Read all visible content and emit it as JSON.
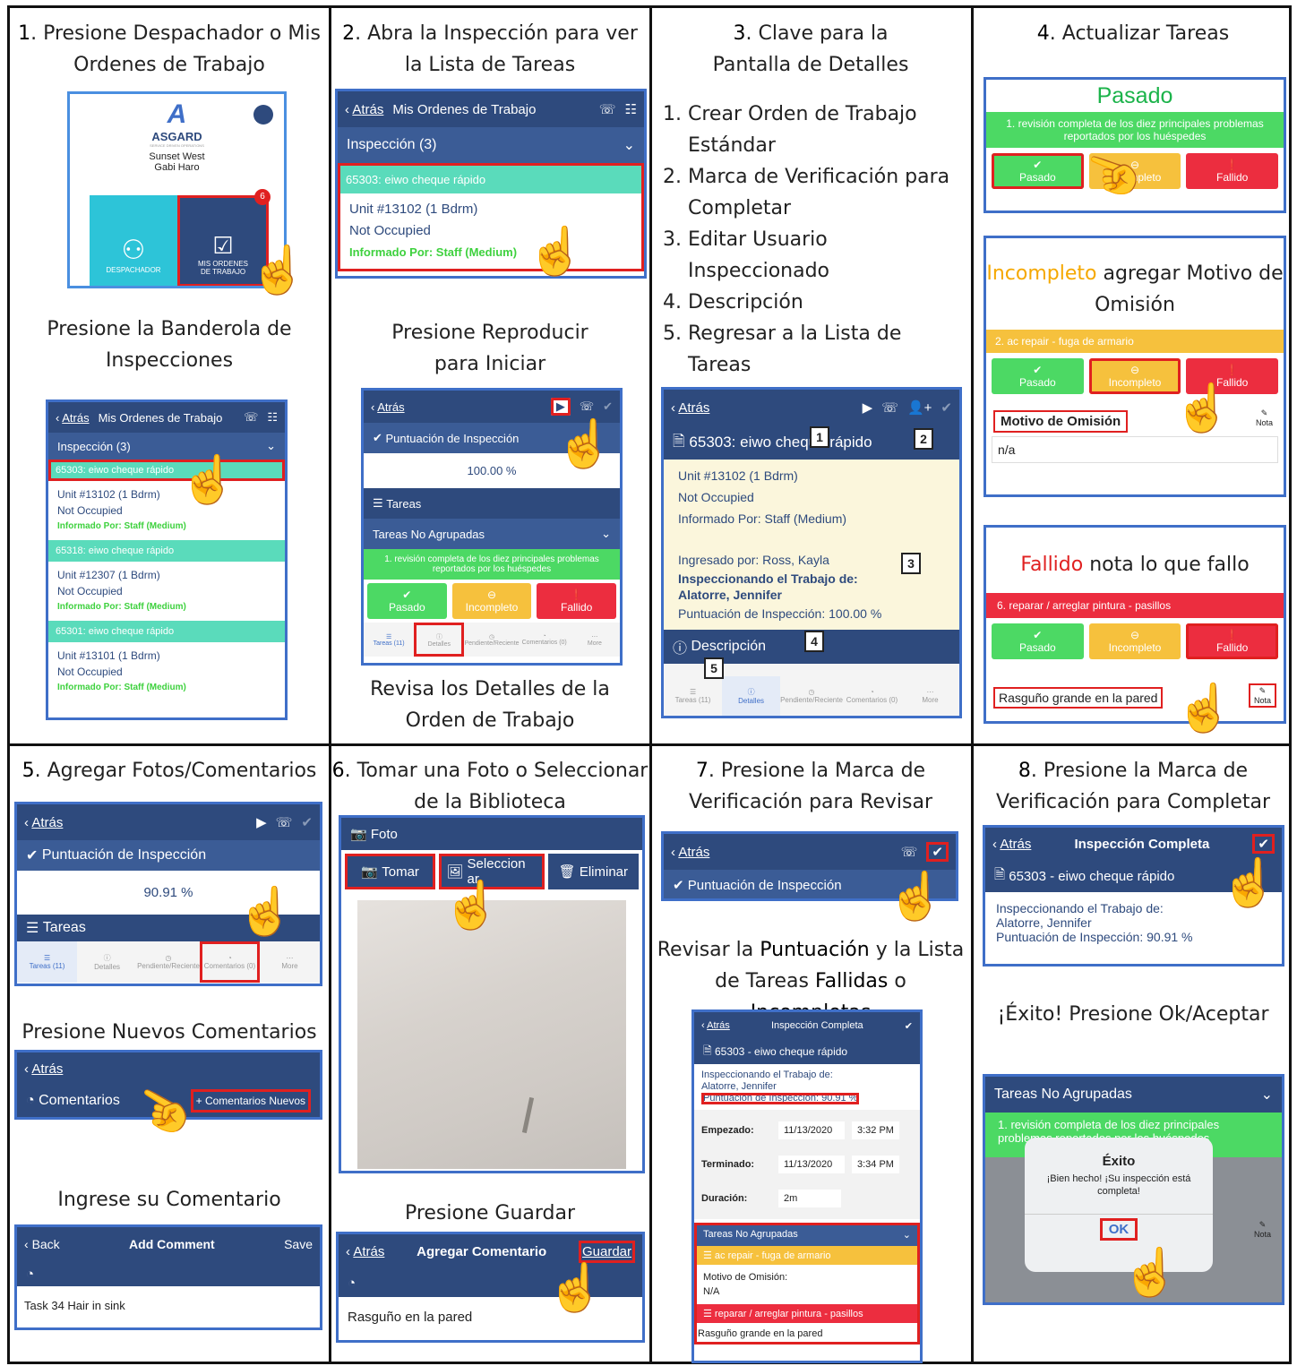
{
  "steps": [
    {
      "n": "1",
      "title": "Presione Despachador o Mis Ordenes de Trabajo",
      "sub": "Presione la Banderola de Inspecciones"
    },
    {
      "n": "2",
      "title": "Abra la Inspección para ver la Lista de Tareas",
      "sub": "Presione Reproducir para Iniciar",
      "sub2": "Revisa los Detalles de la Orden de Trabajo"
    },
    {
      "n": "3",
      "title": "Clave para la Pantalla de Detalles",
      "list": [
        "Crear Orden de Trabajo Estándar",
        "Marca de Verificación para Completar",
        "Editar Usuario Inspeccionado",
        "Descripción",
        "Regresar a la Lista de Tareas"
      ]
    },
    {
      "n": "4",
      "title": "Actualizar Tareas",
      "pass": "Pasado",
      "inc_word": "Incompleto",
      "inc_rest": "agregar Motivo de Omisión",
      "fail_word": "Fallido",
      "fail_rest": "nota lo que fallo"
    },
    {
      "n": "5",
      "title": "Agregar Fotos/Comentarios",
      "sub": "Presione Nuevos Comentarios",
      "sub2": "Ingrese su Comentario"
    },
    {
      "n": "6",
      "title": "Tomar una Foto o Seleccionar de la Biblioteca",
      "sub": "Presione Guardar"
    },
    {
      "n": "7",
      "title": "Presione la Marca de Verificación para Revisar",
      "r1": "Revisar la",
      "r2": "Puntuación",
      "r3": "y la Lista de Tareas",
      "r4": "Fallidas",
      "r5": "o",
      "r6": "Incompletas"
    },
    {
      "n": "8",
      "title": "Presione la Marca de Verificación para Completar",
      "sub": "¡Éxito! Presione Ok/Aceptar"
    }
  ],
  "ui": {
    "asgard": "ASGARD",
    "asgard_sub": "SERVICE DRIVEN OPERATIONS",
    "location": "Sunset West",
    "user": "Gabi Haro",
    "despachador": "DESPACHADOR",
    "mis": "MIS ORDENES DE TRABAJO",
    "badge6": "6",
    "back": "Atrás",
    "mis_title": "Mis Ordenes de Trabajo",
    "insp3": "Inspección (3)",
    "wo1": "65303: eiwo cheque rápido",
    "wo2": "65318: eiwo cheque rápido",
    "wo3": "65301: eiwo cheque rápido",
    "unit1": "Unit #13102 (1 Bdrm)",
    "unit2": "Unit #12307 (1 Bdrm)",
    "unit3": "Unit #13101 (1 Bdrm)",
    "notocc": "Not Occupied",
    "inform": "Informado Por: Staff  (Medium)",
    "punt": "Puntuación de Inspección",
    "pct100": "100.00 %",
    "pct90": "90.91 %",
    "tareas": "Tareas",
    "tna": "Tareas No Agrupadas",
    "task1": "1. revisión completa de los diez principales problemas reportados por los huéspedes",
    "pasado": "Pasado",
    "incompleto": "Incompleto",
    "fallido": "Fallido",
    "tab_tareas": "Tareas (11)",
    "tab_det": "Detalles",
    "tab_pend": "Pendiente/Reciente",
    "tab_com": "Comentarios (0)",
    "tab_more": "More",
    "det_title": "65303: eiwo cheque rápido",
    "ingresado": "Ingresado por: Ross, Kayla",
    "insp_trab": "Inspeccionando el Trabajo de:",
    "alatorre": "Alatorre, Jennifer",
    "punt100": "Puntuación de Inspección: 100.00 %",
    "descripcion": "Descripción",
    "task2": "2. ac repair - fuga de armario",
    "motivo": "Motivo de Omisión",
    "na": "n/a",
    "nota": "Nota",
    "task6": "6. reparar / arreglar pintura - pasillos",
    "rasguno": "Rasguño grande en la pared",
    "comentarios": "Comentarios",
    "com_nuevos": "+ Comentarios Nuevos",
    "backE": "Back",
    "add_comment": "Add Comment",
    "save": "Save",
    "comment_text": "Task 34 Hair in sink",
    "foto": "Foto",
    "tomar": "Tomar",
    "selecc": "Seleccion ar",
    "eliminar": "Eliminar",
    "agregar_com": "Agregar Comentario",
    "guardar": "Guardar",
    "rasguno2": "Rasguño en la pared",
    "insp_comp": "Inspección Completa",
    "wo_dash": "65303 - eiwo cheque rápido",
    "punt9091": "Puntuación de Inspección: 90.91 %",
    "empezado": "Empezado:",
    "terminado": "Terminado:",
    "duracion": "Duración:",
    "date": "11/13/2020",
    "t1": "3:32 PM",
    "t2": "3:34 PM",
    "dur": "2m",
    "ac_repair": "ac repair - fuga de armario",
    "motivo_c": "Motivo de Omisión:",
    "NA": "N/A",
    "pintura": "reparar / arreglar pintura - pasillos",
    "exito": "Éxito",
    "exito_msg": "¡Bien hecho! ¡Su inspección está completa!",
    "ok": "OK"
  }
}
